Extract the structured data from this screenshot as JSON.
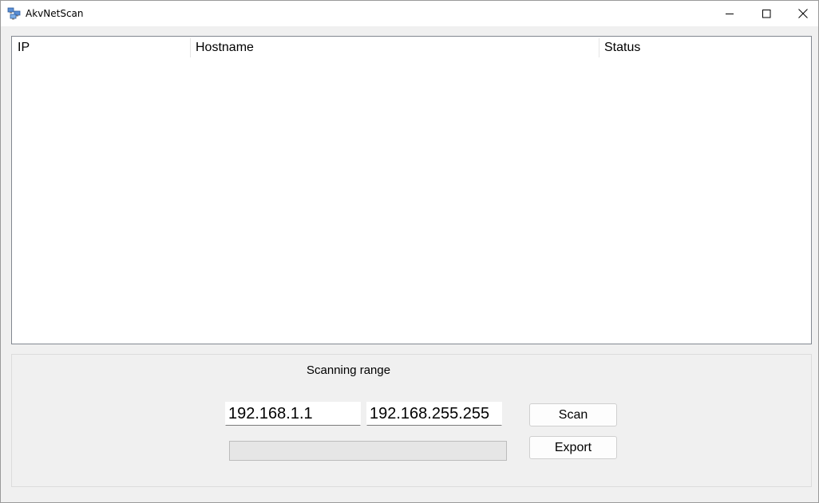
{
  "window": {
    "title": "AkvNetScan",
    "icon": "network-computers-icon",
    "controls": {
      "minimize": "minimize-icon",
      "maximize": "maximize-icon",
      "close": "close-icon"
    }
  },
  "list": {
    "columns": [
      "IP",
      "Hostname",
      "Status"
    ],
    "rows": []
  },
  "scan": {
    "range_label": "Scanning range",
    "start_ip": "192.168.1.1",
    "end_ip": "192.168.255.255",
    "scan_label": "Scan",
    "export_label": "Export",
    "progress": 0
  },
  "colors": {
    "background": "#f0f0f0",
    "list_background": "#ffffff",
    "progress_fill": "#06b025"
  }
}
